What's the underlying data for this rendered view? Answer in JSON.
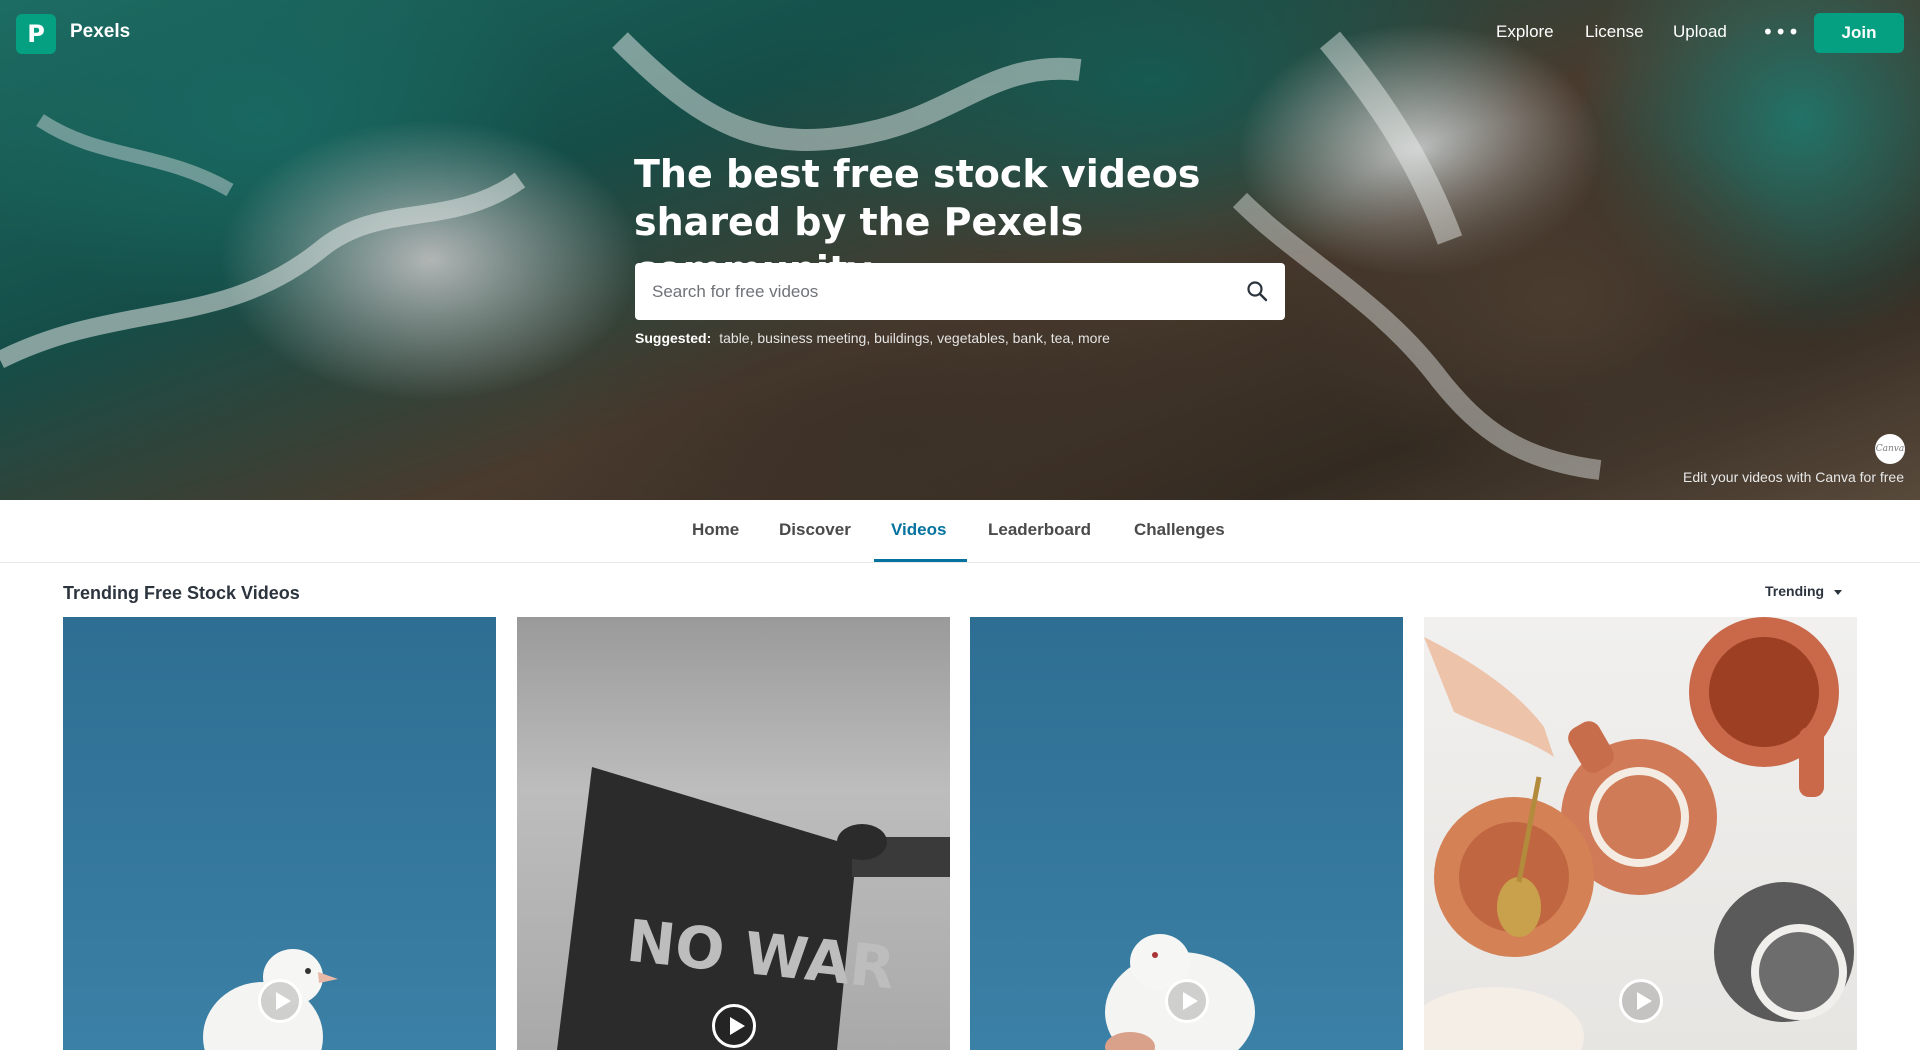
{
  "brand": {
    "logo_letter": "P",
    "name": "Pexels",
    "accent": "#05a081"
  },
  "topnav": {
    "explore": "Explore",
    "license": "License",
    "upload": "Upload",
    "more": "•••",
    "join": "Join"
  },
  "hero": {
    "title": "The best free stock videos shared by the Pexels community.",
    "search_placeholder": "Search for free videos",
    "suggested_label": "Suggested:",
    "suggested_tags": "table, business meeting, buildings, vegetables, bank, tea, more",
    "canva_badge": "Canva",
    "canva_text": "Edit your videos with Canva for free"
  },
  "tabs": {
    "home": "Home",
    "discover": "Discover",
    "videos": "Videos",
    "leaderboard": "Leaderboard",
    "challenges": "Challenges",
    "active": "Videos",
    "active_color": "#05729f"
  },
  "section": {
    "title": "Trending Free Stock Videos",
    "sort": "Trending"
  },
  "cards": [
    {
      "subject": "white dove on blue background",
      "icon": "play-icon"
    },
    {
      "subject": "no war sign",
      "icon": "play-icon",
      "overlay_text": "NO WAR"
    },
    {
      "subject": "white dove held by hand",
      "icon": "play-icon"
    },
    {
      "subject": "tea set on white table",
      "icon": "play-icon"
    }
  ]
}
